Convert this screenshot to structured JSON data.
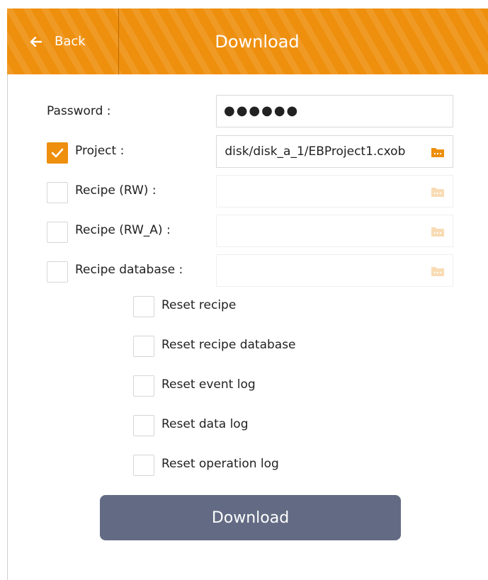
{
  "header": {
    "back_label": "Back",
    "title": "Download"
  },
  "form": {
    "password": {
      "label": "Password :",
      "value": "●●●●●●"
    },
    "project": {
      "label": "Project :",
      "checked": true,
      "value": " disk/disk_a_1/EBProject1.cxob"
    },
    "recipe_rw": {
      "label": "Recipe (RW) :",
      "checked": false,
      "value": ""
    },
    "recipe_rw_a": {
      "label": "Recipe (RW_A) :",
      "checked": false,
      "value": ""
    },
    "recipe_database": {
      "label": "Recipe database :",
      "checked": false,
      "value": ""
    },
    "resets": [
      {
        "label": "Reset recipe",
        "checked": false
      },
      {
        "label": "Reset recipe database",
        "checked": false
      },
      {
        "label": "Reset event log",
        "checked": false
      },
      {
        "label": "Reset data log",
        "checked": false
      },
      {
        "label": "Reset operation log",
        "checked": false
      }
    ]
  },
  "download_button": {
    "label": "Download"
  },
  "colors": {
    "accent": "#ee8f0d",
    "button": "#636b84",
    "folder_disabled": "#f8dcb5"
  },
  "icons": {
    "back": "arrow-left-icon",
    "folder": "folder-icon",
    "check": "checkmark-icon"
  }
}
